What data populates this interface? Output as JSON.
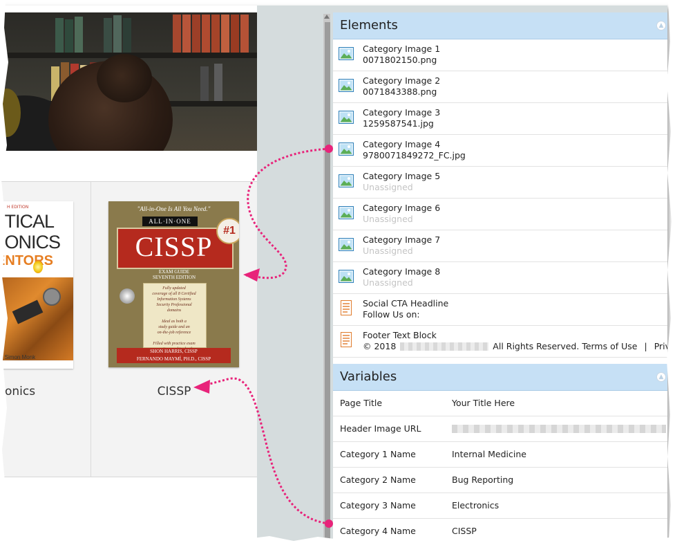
{
  "elements_panel": {
    "title": "Elements",
    "items": [
      {
        "name": "Category Image 1",
        "value": "0071802150.png",
        "assigned": true,
        "icon": "image-icon"
      },
      {
        "name": "Category Image 2",
        "value": "0071843388.png",
        "assigned": true,
        "icon": "image-icon"
      },
      {
        "name": "Category Image 3",
        "value": "1259587541.jpg",
        "assigned": true,
        "icon": "image-icon"
      },
      {
        "name": "Category Image 4",
        "value": "9780071849272_FC.jpg",
        "assigned": true,
        "icon": "image-icon"
      },
      {
        "name": "Category Image 5",
        "value": "Unassigned",
        "assigned": false,
        "icon": "image-icon"
      },
      {
        "name": "Category Image 6",
        "value": "Unassigned",
        "assigned": false,
        "icon": "image-icon"
      },
      {
        "name": "Category Image 7",
        "value": "Unassigned",
        "assigned": false,
        "icon": "image-icon"
      },
      {
        "name": "Category Image 8",
        "value": "Unassigned",
        "assigned": false,
        "icon": "image-icon"
      },
      {
        "name": "Social CTA Headline",
        "value": "Follow Us on:",
        "assigned": true,
        "icon": "text-block-icon"
      }
    ],
    "footer": {
      "name": "Footer Text Block",
      "prefix": "© 2018",
      "rights": "All Rights Reserved.",
      "terms": "Terms of Use",
      "separator": "|",
      "privacy": "Privacy P",
      "icon": "text-block-icon"
    }
  },
  "variables_panel": {
    "title": "Variables",
    "items": [
      {
        "name": "Page Title",
        "value": "Your Title Here"
      },
      {
        "name": "Header Image URL",
        "value": ""
      },
      {
        "name": "Category 1 Name",
        "value": "Internal Medicine"
      },
      {
        "name": "Category 2 Name",
        "value": "Bug Reporting"
      },
      {
        "name": "Category 3 Name",
        "value": "Electronics"
      },
      {
        "name": "Category 4 Name",
        "value": "CISSP"
      }
    ]
  },
  "preview": {
    "category_labels": [
      "onics",
      "CISSP"
    ],
    "electronics_cover": {
      "edition": "H EDITION",
      "line1": "CTICAL",
      "line2": "RONICS",
      "line3": "ENTORS",
      "author": "d Simon Monk"
    },
    "cissp_cover": {
      "quote": "\"All-in-One Is All You Need.\"",
      "series": "ALL·IN·ONE",
      "title": "CISSP",
      "badge": "#1",
      "exam_guide": "EXAM GUIDE\nSEVENTH EDITION",
      "panel_text": "Fully updated\ncoverage of all 8 Certified\nInformation Systems\nSecurity Professional\ndomains\n\nIdeal as both a\nstudy guide and an\non-the-job reference\n\nFilled with practice exam\nquestions and in-depth\nexplanations",
      "authors": "SHON HARRIS, CISSP\nFERNANDO MAYMÍ, PH.D., CISSP"
    }
  },
  "colors": {
    "section_header": "#c6e0f5",
    "annotation": "#e8237a",
    "unassigned": "#c4c4c4"
  }
}
